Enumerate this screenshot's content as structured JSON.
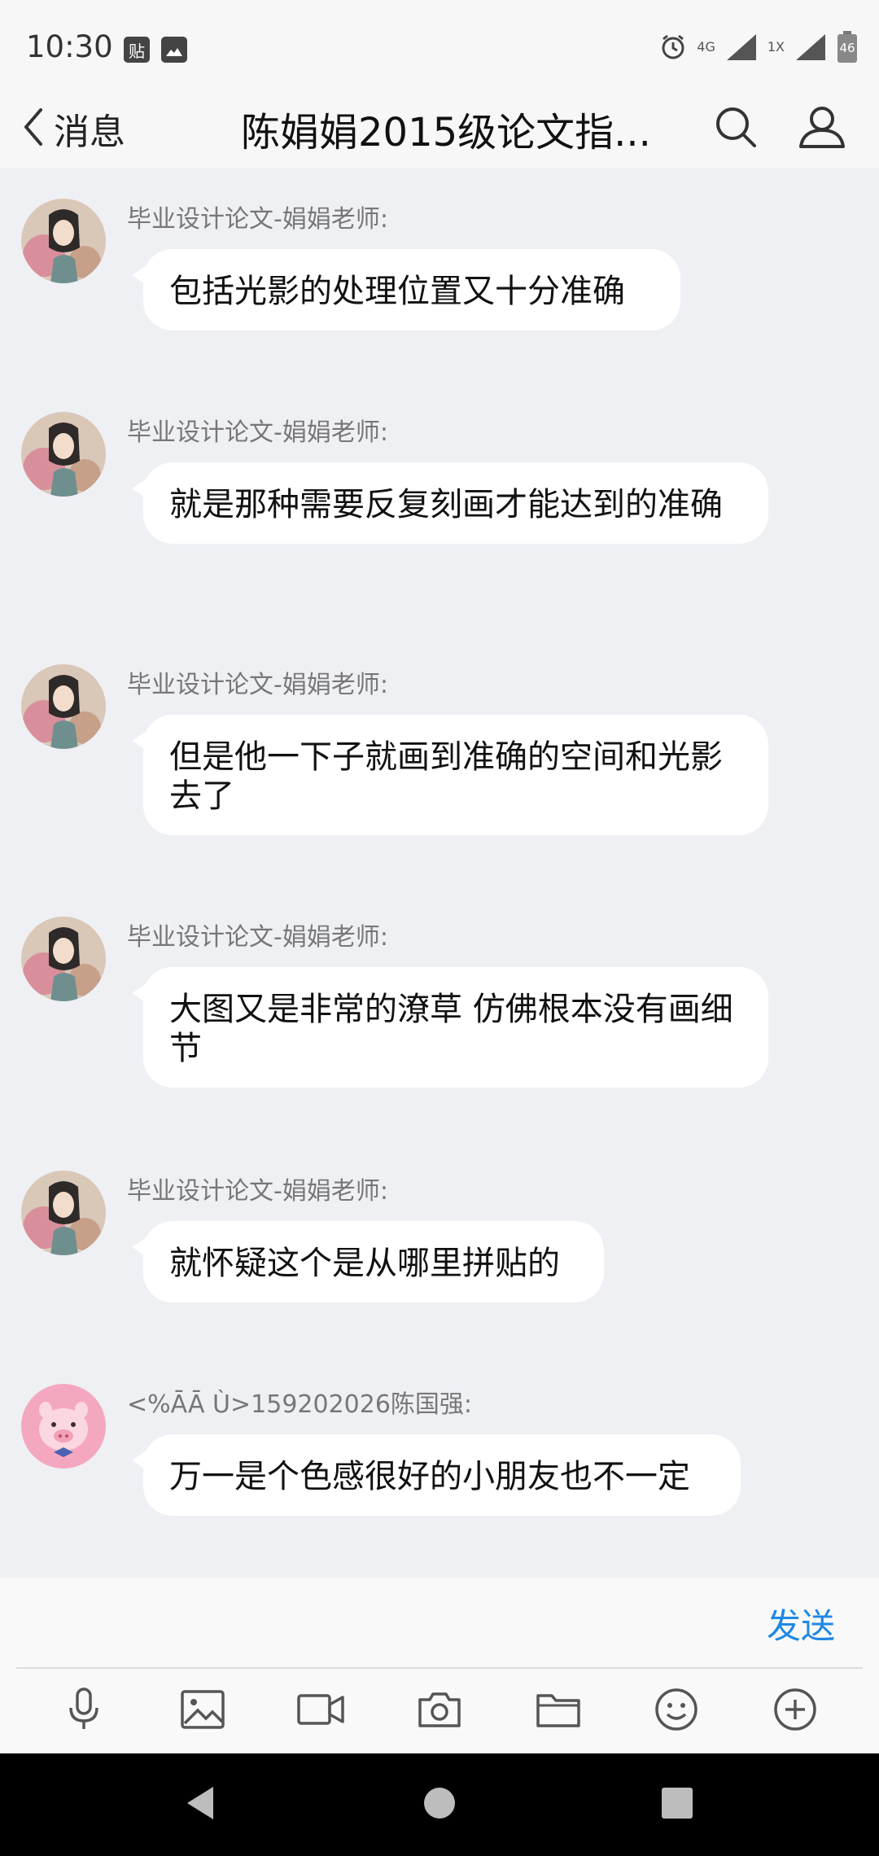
{
  "status_bar": {
    "time": "10:30",
    "left_badge": "贴",
    "net_4g": "4G",
    "net_1x": "1X",
    "battery": "46"
  },
  "header": {
    "back_label": "消息",
    "title": "陈娟娟2015级论文指...",
    "search_icon": "search-icon",
    "profile_icon": "person-icon"
  },
  "messages": [
    {
      "sender": "毕业设计论文-娟娟老师:",
      "text": "包括光影的处理位置又十分准确",
      "avatar": "teacher-avatar"
    },
    {
      "sender": "毕业设计论文-娟娟老师:",
      "text": "就是那种需要反复刻画才能达到的准确",
      "avatar": "teacher-avatar"
    },
    {
      "sender": "毕业设计论文-娟娟老师:",
      "text": "但是他一下子就画到准确的空间和光影去了",
      "avatar": "teacher-avatar"
    },
    {
      "sender": "毕业设计论文-娟娟老师:",
      "text": "大图又是非常的潦草 仿佛根本没有画细节",
      "avatar": "teacher-avatar"
    },
    {
      "sender": "毕业设计论文-娟娟老师:",
      "text": "就怀疑这个是从哪里拼贴的",
      "avatar": "teacher-avatar"
    },
    {
      "sender": "<%ĀĀ Ù>159202026陈国强:",
      "text": "万一是个色感很好的小朋友也不一定",
      "avatar": "pig-avatar"
    }
  ],
  "input": {
    "value": "",
    "send_label": "发送"
  },
  "toolbar": [
    "microphone-icon",
    "image-icon",
    "video-icon",
    "camera-icon",
    "folder-icon",
    "emoji-icon",
    "plus-icon"
  ],
  "colors": {
    "accent": "#1e88e5",
    "chat_background": "#eff0f4",
    "bubble": "#ffffff"
  }
}
